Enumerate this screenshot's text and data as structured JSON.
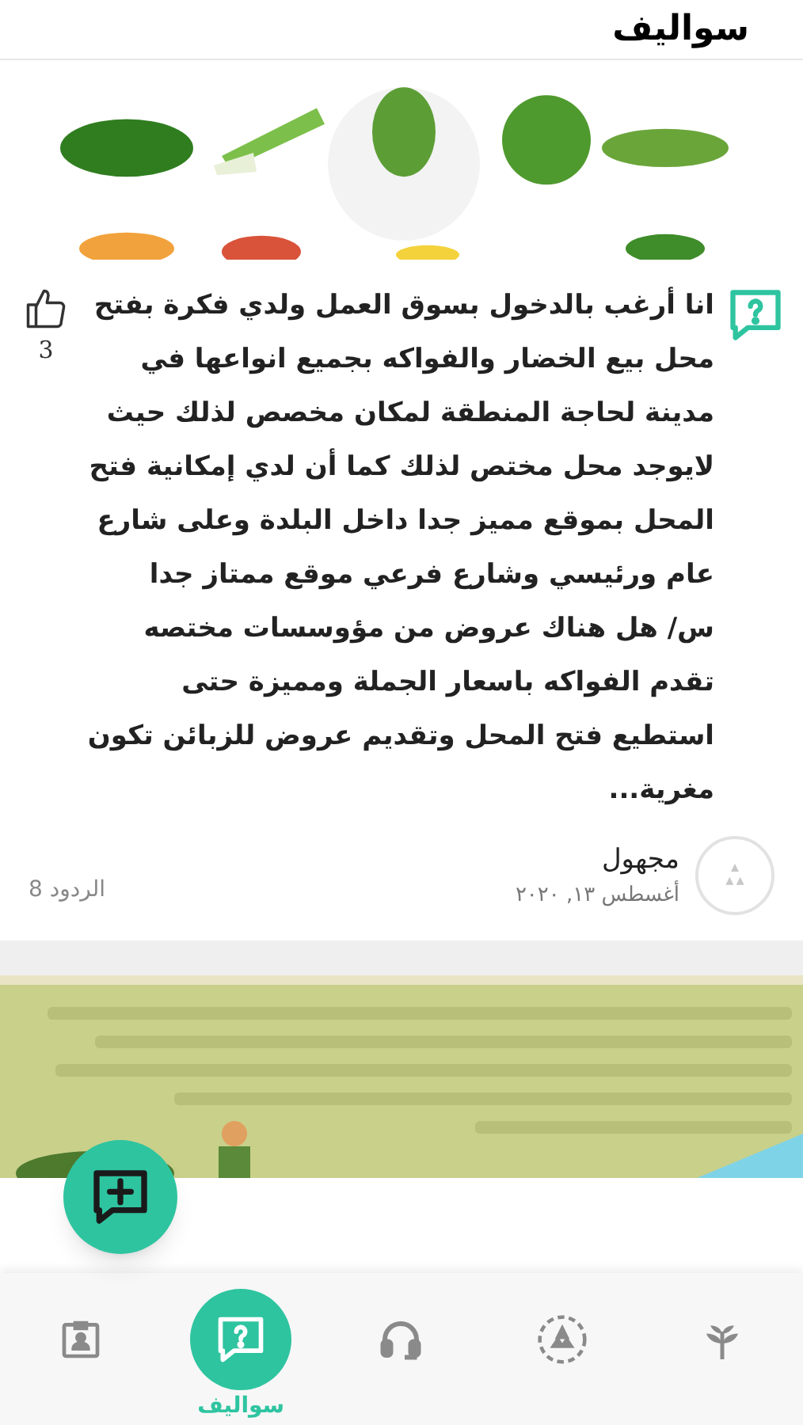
{
  "header": {
    "title": "سواليف"
  },
  "post": {
    "text": "انا أرغب بالدخول بسوق العمل ولدي فكرة بفتح محل بيع الخضار والفواكه بجميع انواعها في مدينة لحاجة المنطقة لمكان مخصص لذلك حيث لايوجد محل مختص لذلك كما أن لدي إمكانية فتح المحل بموقع مميز جدا داخل البلدة وعلى شارع عام ورئيسي وشارع فرعي موقع ممتاز جدا\nس/ هل هناك عروض من مؤوسسات مختصه تقدم الفواكه باسعار الجملة ومميزة حتى استطيع فتح المحل وتقديم عروض للزبائن تكون مغرية...",
    "likes": "3",
    "liked": false,
    "author": "مجهول",
    "date": "أغسطس ١٣, ٢٠٢٠",
    "replies": "الردود 8"
  },
  "nav": [
    {
      "kind": "plant",
      "selected": false
    },
    {
      "kind": "community",
      "selected": false
    },
    {
      "kind": "support",
      "selected": false
    },
    {
      "kind": "questions",
      "selected": true,
      "label": "سواليف"
    },
    {
      "kind": "profile",
      "selected": false
    }
  ]
}
